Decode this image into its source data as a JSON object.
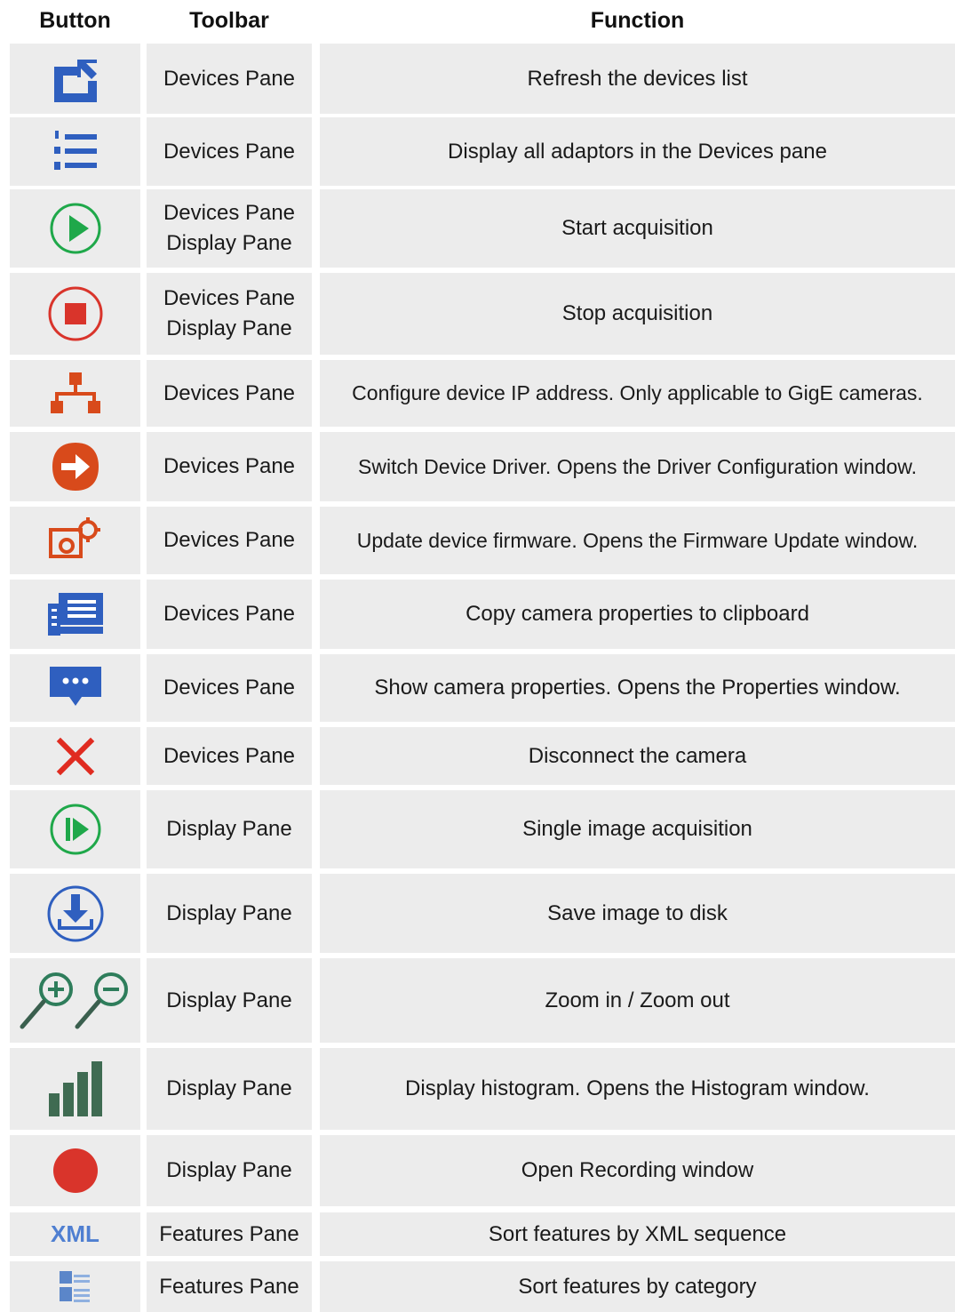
{
  "headers": {
    "button": "Button",
    "toolbar": "Toolbar",
    "function": "Function"
  },
  "rows": [
    {
      "icon": "refresh-icon",
      "toolbar": [
        "Devices Pane"
      ],
      "function": "Refresh the devices list"
    },
    {
      "icon": "numbered-list-icon",
      "toolbar": [
        "Devices Pane"
      ],
      "function": "Display all adaptors in the Devices pane"
    },
    {
      "icon": "play-icon",
      "toolbar": [
        "Devices Pane",
        "Display Pane"
      ],
      "function": "Start acquisition"
    },
    {
      "icon": "stop-icon",
      "toolbar": [
        "Devices Pane",
        "Display Pane"
      ],
      "function": "Stop acquisition"
    },
    {
      "icon": "network-icon",
      "toolbar": [
        "Devices Pane"
      ],
      "function": "Configure device IP address. Only applicable to GigE cameras."
    },
    {
      "icon": "switch-driver-icon",
      "toolbar": [
        "Devices Pane"
      ],
      "function": "Switch Device Driver. Opens the Driver Configuration window."
    },
    {
      "icon": "firmware-update-icon",
      "toolbar": [
        "Devices Pane"
      ],
      "function": "Update device firmware. Opens the Firmware Update window."
    },
    {
      "icon": "copy-properties-icon",
      "toolbar": [
        "Devices Pane"
      ],
      "function": "Copy camera properties to clipboard"
    },
    {
      "icon": "properties-icon",
      "toolbar": [
        "Devices Pane"
      ],
      "function": "Show camera properties. Opens the Properties window."
    },
    {
      "icon": "disconnect-icon",
      "toolbar": [
        "Devices Pane"
      ],
      "function": "Disconnect the camera"
    },
    {
      "icon": "single-acquisition-icon",
      "toolbar": [
        "Display Pane"
      ],
      "function": "Single image acquisition"
    },
    {
      "icon": "save-icon",
      "toolbar": [
        "Display Pane"
      ],
      "function": "Save image to disk"
    },
    {
      "icon": "zoom-icon",
      "toolbar": [
        "Display Pane"
      ],
      "function": "Zoom in / Zoom out"
    },
    {
      "icon": "histogram-icon",
      "toolbar": [
        "Display Pane"
      ],
      "function": "Display histogram. Opens the Histogram window."
    },
    {
      "icon": "record-icon",
      "toolbar": [
        "Display Pane"
      ],
      "function": "Open Recording window"
    },
    {
      "icon": "xml-sort-icon",
      "icon_text": "XML",
      "toolbar": [
        "Features Pane"
      ],
      "function": "Sort features by XML sequence"
    },
    {
      "icon": "category-sort-icon",
      "toolbar": [
        "Features Pane"
      ],
      "function": "Sort features by category"
    }
  ],
  "colors": {
    "blue": "#2f5fbf",
    "green": "#1fa84a",
    "red": "#d9342b",
    "orange_red": "#d84a1b",
    "dark_green": "#3f6b52",
    "cell_bg": "#ececec"
  }
}
